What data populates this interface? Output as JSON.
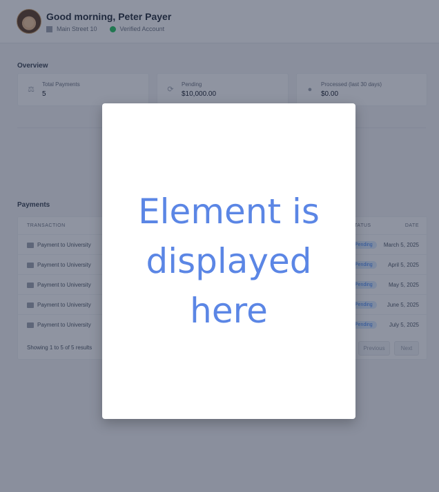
{
  "header": {
    "greeting": "Good morning, Peter Payer",
    "address": "Main Street 10",
    "verified": "Verified Account"
  },
  "overview": {
    "title": "Overview",
    "cards": [
      {
        "icon": "scale-icon",
        "label": "Total Payments",
        "value": "5"
      },
      {
        "icon": "refresh-icon",
        "label": "Pending",
        "value": "$10,000.00"
      },
      {
        "icon": "check-circle-icon",
        "label": "Processed (last 30 days)",
        "value": "$0.00"
      }
    ]
  },
  "payments": {
    "title": "Payments",
    "columns": [
      "TRANSACTION",
      "STATUS",
      "DATE"
    ],
    "rows": [
      {
        "description": "Payment to University",
        "status": "Pending",
        "date": "March 5, 2025"
      },
      {
        "description": "Payment to University",
        "status": "Pending",
        "date": "April 5, 2025"
      },
      {
        "description": "Payment to University",
        "status": "Pending",
        "date": "May 5, 2025"
      },
      {
        "description": "Payment to University",
        "status": "Pending",
        "date": "June 5, 2025"
      },
      {
        "description": "Payment to University",
        "status": "Pending",
        "date": "July 5, 2025"
      }
    ],
    "footer": "Showing 1 to 5 of 5 results",
    "prev_label": "Previous",
    "next_label": "Next"
  },
  "modal": {
    "text": "Element is displayed here"
  },
  "colors": {
    "accent": "#5b86e5",
    "verified": "#22c55e",
    "badge": "#3b82f6"
  }
}
